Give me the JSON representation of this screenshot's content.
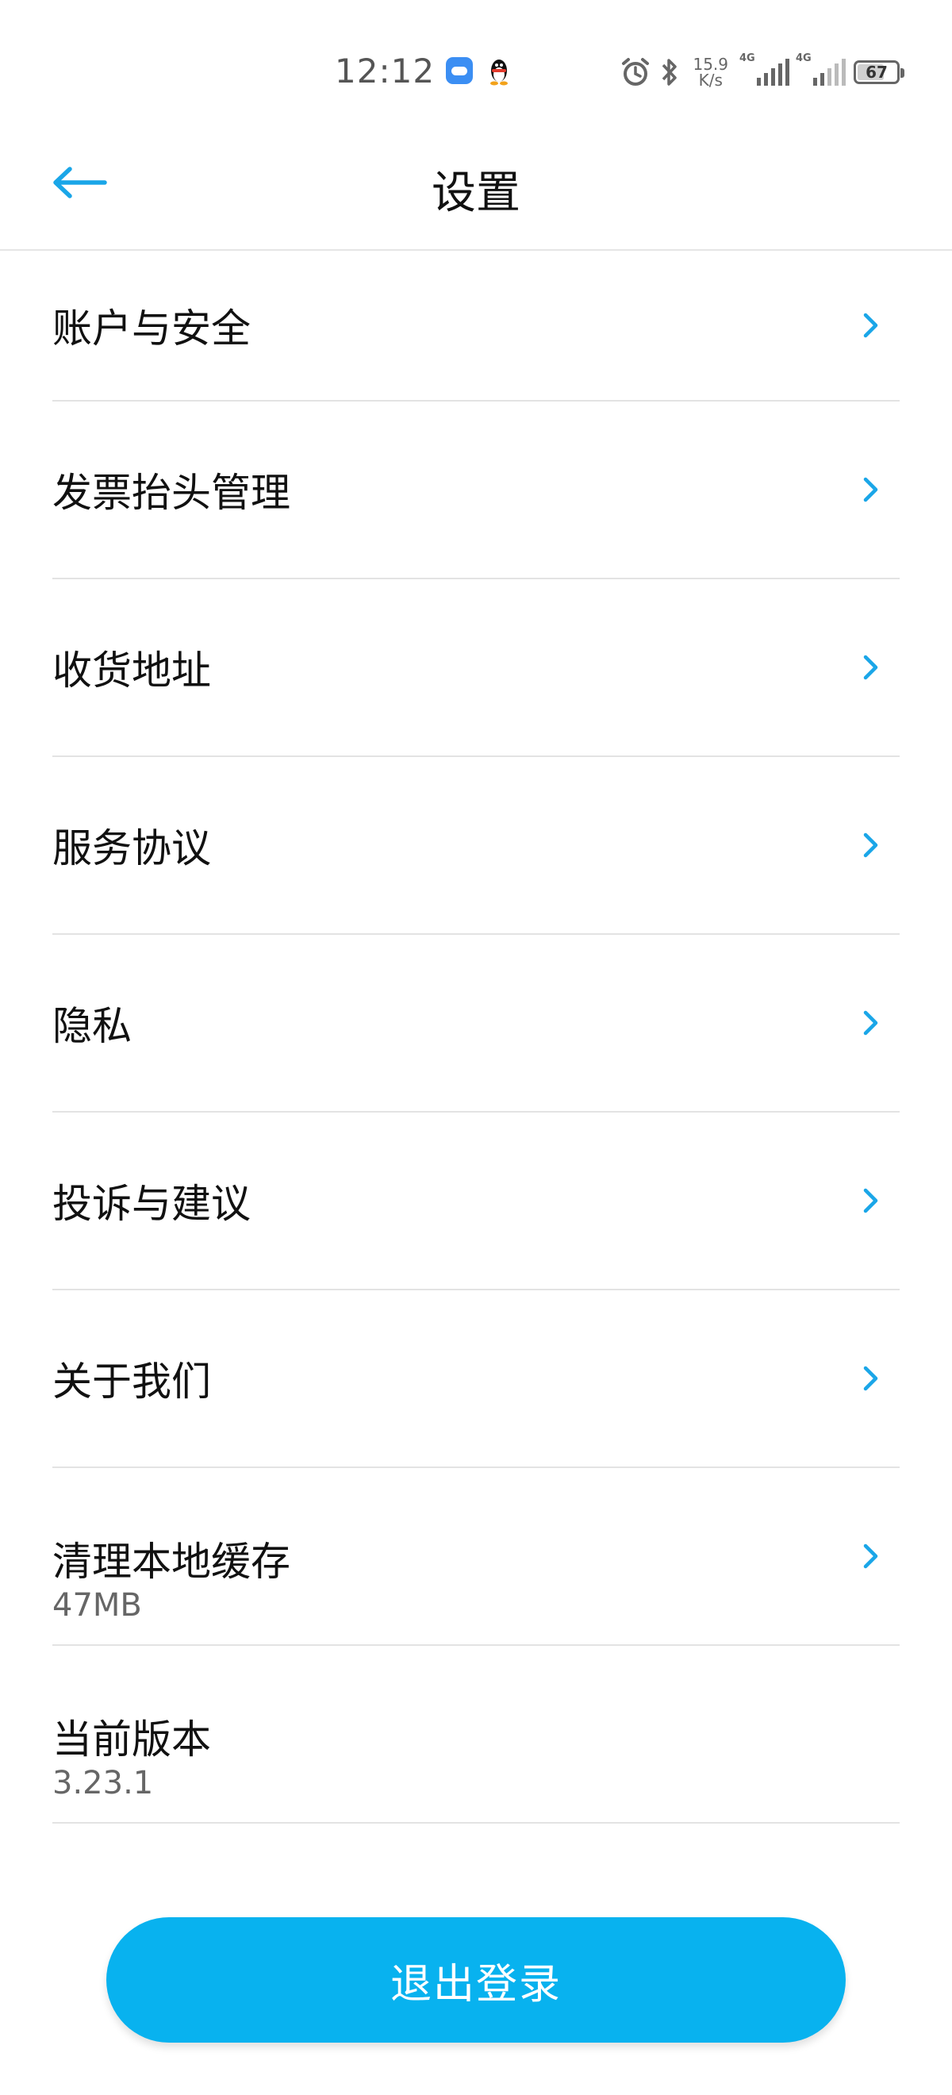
{
  "status_bar": {
    "time": "12:12",
    "net_speed_value": "15.9",
    "net_speed_unit": "K/s",
    "signal1_label": "4G",
    "signal2_label": "4G",
    "battery": "67"
  },
  "header": {
    "title": "设置"
  },
  "settings": {
    "items": [
      {
        "label": "账户与安全"
      },
      {
        "label": "发票抬头管理"
      },
      {
        "label": "收货地址"
      },
      {
        "label": "服务协议"
      },
      {
        "label": "隐私"
      },
      {
        "label": "投诉与建议"
      },
      {
        "label": "关于我们"
      },
      {
        "label": "清理本地缓存",
        "value": "47MB"
      },
      {
        "label": "当前版本",
        "value": "3.23.1"
      }
    ]
  },
  "logout": {
    "label": "退出登录"
  },
  "colors": {
    "accent": "#08b2ef",
    "back_arrow": "#1aa6e8",
    "chevron": "#1aa6e8"
  }
}
